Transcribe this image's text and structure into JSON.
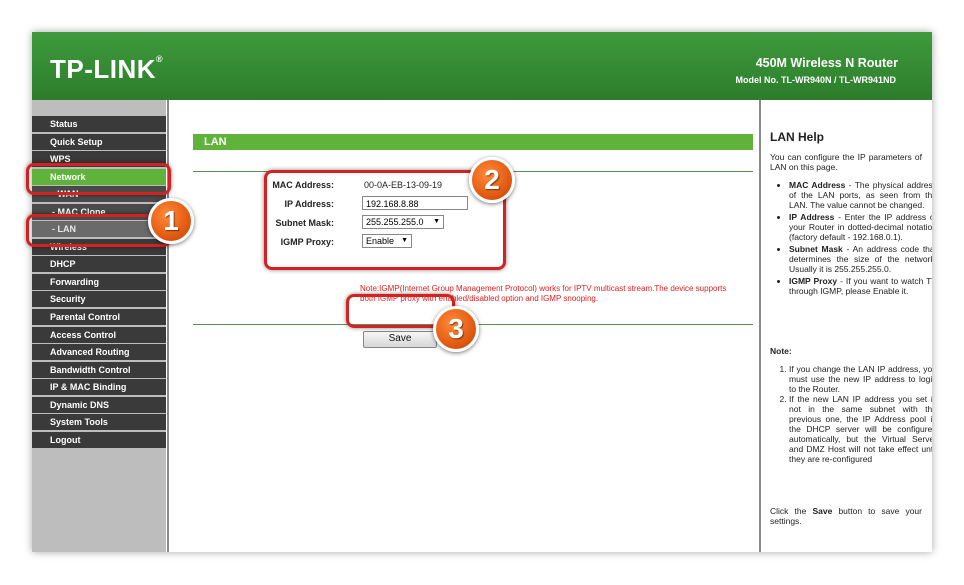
{
  "header": {
    "logo": "TP-LINK",
    "logo_mark": "®",
    "router_title": "450M Wireless N Router",
    "model": "Model No. TL-WR940N / TL-WR941ND"
  },
  "sidebar": {
    "items": [
      {
        "label": "Status"
      },
      {
        "label": "Quick Setup"
      },
      {
        "label": "WPS"
      },
      {
        "label": "Network"
      },
      {
        "label": "- WAN"
      },
      {
        "label": "- MAC Clone"
      },
      {
        "label": "- LAN"
      },
      {
        "label": "Wireless"
      },
      {
        "label": "DHCP"
      },
      {
        "label": "Forwarding"
      },
      {
        "label": "Security"
      },
      {
        "label": "Parental Control"
      },
      {
        "label": "Access Control"
      },
      {
        "label": "Advanced Routing"
      },
      {
        "label": "Bandwidth Control"
      },
      {
        "label": "IP & MAC Binding"
      },
      {
        "label": "Dynamic DNS"
      },
      {
        "label": "System Tools"
      },
      {
        "label": "Logout"
      }
    ]
  },
  "main": {
    "section_title": "LAN",
    "mac_label": "MAC Address:",
    "mac_value": "00-0A-EB-13-09-19",
    "ip_label": "IP Address:",
    "ip_value": "192.168.8.88",
    "mask_label": "Subnet Mask:",
    "mask_value": "255.255.255.0",
    "igmp_label": "IGMP Proxy:",
    "igmp_value": "Enable",
    "note": "Note:IGMP(Internet Group Management Protocol) works for IPTV multicast stream.The device supports both IGMP proxy with enabled/disabled option and IGMP snooping.",
    "save_label": "Save"
  },
  "help": {
    "title": "LAN Help",
    "intro": "You can configure the IP parameters of LAN on this page.",
    "items": [
      {
        "term": "MAC Address",
        "text": " - The physical address of the LAN ports, as seen from the LAN. The value cannot be changed."
      },
      {
        "term": "IP Address",
        "text": " - Enter the IP address of your Router in dotted-decimal notation (factory default - 192.168.0.1)."
      },
      {
        "term": "Subnet Mask",
        "text": " - An address code that determines the size of the network. Usually it is 255.255.255.0."
      },
      {
        "term": "IGMP Proxy",
        "text": " - If you want to watch TV through IGMP, please Enable it."
      }
    ],
    "note_title": "Note:",
    "notes": [
      "If you change the LAN IP address, you must use the new IP address to login to the Router.",
      "If the new LAN IP address you set is not in the same subnet with the previous one, the IP Address pool in the DHCP server will be configured automatically, but the Virtual Server and DMZ Host will not take effect until they are re-configured"
    ],
    "footer_pre": "Click the ",
    "footer_bold": "Save",
    "footer_post": " button to save your settings."
  },
  "callouts": {
    "one": "1",
    "two": "2",
    "three": "3"
  },
  "colors": {
    "brand_green": "#3f9a3d",
    "menu_dark": "#3a3a3a",
    "menu_active": "#5fb33a",
    "callout_red": "#d42121",
    "badge_orange": "#e35b12"
  }
}
